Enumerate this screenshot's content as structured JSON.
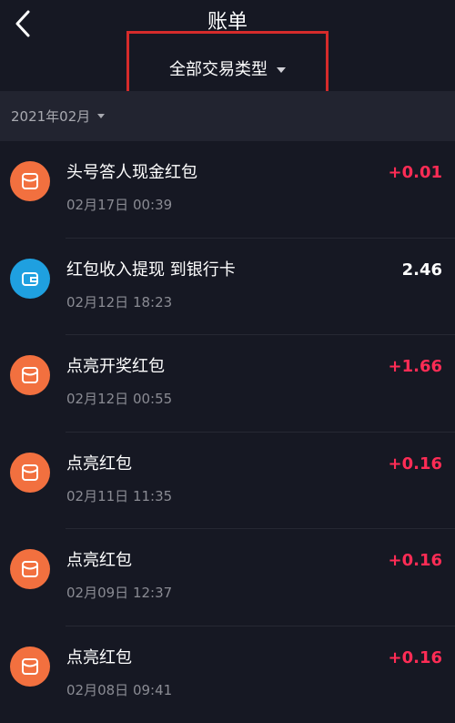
{
  "header": {
    "title": "账单",
    "back_icon": "chevron-left-icon"
  },
  "filter": {
    "label": "全部交易类型",
    "highlight_color": "#d62b2b"
  },
  "month": {
    "label": "2021年02月"
  },
  "colors": {
    "background": "#161823",
    "month_bar": "#222430",
    "income": "#fe2c55",
    "red_packet_icon": "#f2703f",
    "wallet_icon": "#1fa0e0"
  },
  "transactions": [
    {
      "title": "头号答人现金红包",
      "time": "02月17日 00:39",
      "amount": "+0.01",
      "icon": "red-packet-icon"
    },
    {
      "title": "红包收入提现 到银行卡",
      "time": "02月12日 18:23",
      "amount": "2.46",
      "icon": "wallet-icon"
    },
    {
      "title": "点亮开奖红包",
      "time": "02月12日 00:55",
      "amount": "+1.66",
      "icon": "red-packet-icon"
    },
    {
      "title": "点亮红包",
      "time": "02月11日 11:35",
      "amount": "+0.16",
      "icon": "red-packet-icon"
    },
    {
      "title": "点亮红包",
      "time": "02月09日 12:37",
      "amount": "+0.16",
      "icon": "red-packet-icon"
    },
    {
      "title": "点亮红包",
      "time": "02月08日 09:41",
      "amount": "+0.16",
      "icon": "red-packet-icon"
    }
  ]
}
